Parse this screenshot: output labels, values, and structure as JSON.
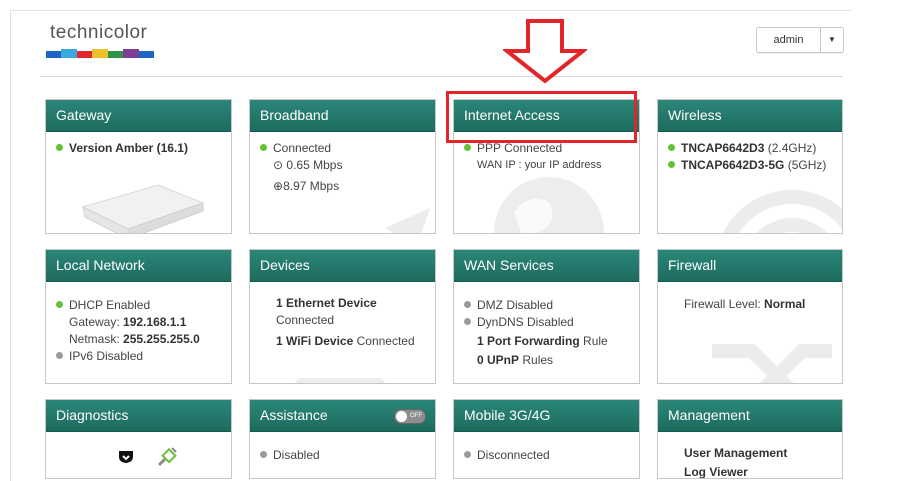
{
  "brand": {
    "logo_text": "technicolor",
    "bar_colors": [
      "#1f65c7",
      "#3aa9e0",
      "#e0282c",
      "#eec22b",
      "#2f9447",
      "#7d3f98",
      "#1f65c7"
    ]
  },
  "header": {
    "user": "admin"
  },
  "colors": {
    "card_header": "#23796c",
    "status_ok": "#65c135",
    "status_off": "#9a9a9a",
    "annotation": "#e32428"
  },
  "cards": {
    "gateway": {
      "title": "Gateway",
      "version": "Version Amber (16.1)"
    },
    "broadband": {
      "title": "Broadband",
      "status": "Connected",
      "upload": "0.65 Mbps",
      "download": "8.97 Mbps"
    },
    "internet": {
      "title": "Internet Access",
      "status": "PPP Connected",
      "wan_ip_label": "WAN IP :",
      "wan_ip_value": "your IP address"
    },
    "wireless": {
      "title": "Wireless",
      "ssid1": "TNCAP6642D3",
      "band1": "(2.4GHz)",
      "ssid2": "TNCAP6642D3-5G",
      "band2": "(5GHz)"
    },
    "local_network": {
      "title": "Local Network",
      "dhcp": "DHCP Enabled",
      "gateway_label": "Gateway:",
      "gateway_value": "192.168.1.1",
      "netmask_label": "Netmask:",
      "netmask_value": "255.255.255.0",
      "ipv6": "IPv6 Disabled"
    },
    "devices": {
      "title": "Devices",
      "eth_count": "1 Ethernet Device",
      "eth_status": "Connected",
      "wifi_count": "1 WiFi Device",
      "wifi_status": "Connected"
    },
    "wan_services": {
      "title": "WAN Services",
      "dmz": "DMZ Disabled",
      "dyndns": "DynDNS Disabled",
      "port_fwd_count": "1 Port Forwarding",
      "port_fwd_suffix": "Rule",
      "upnp_count": "0 UPnP",
      "upnp_suffix": "Rules"
    },
    "firewall": {
      "title": "Firewall",
      "level_label": "Firewall Level:",
      "level_value": "Normal"
    },
    "diagnostics": {
      "title": "Diagnostics"
    },
    "assistance": {
      "title": "Assistance",
      "toggle_label": "OFF",
      "status": "Disabled"
    },
    "mobile": {
      "title": "Mobile 3G/4G",
      "status": "Disconnected"
    },
    "management": {
      "title": "Management",
      "user_mgmt": "User Management",
      "log_viewer": "Log Viewer"
    }
  }
}
